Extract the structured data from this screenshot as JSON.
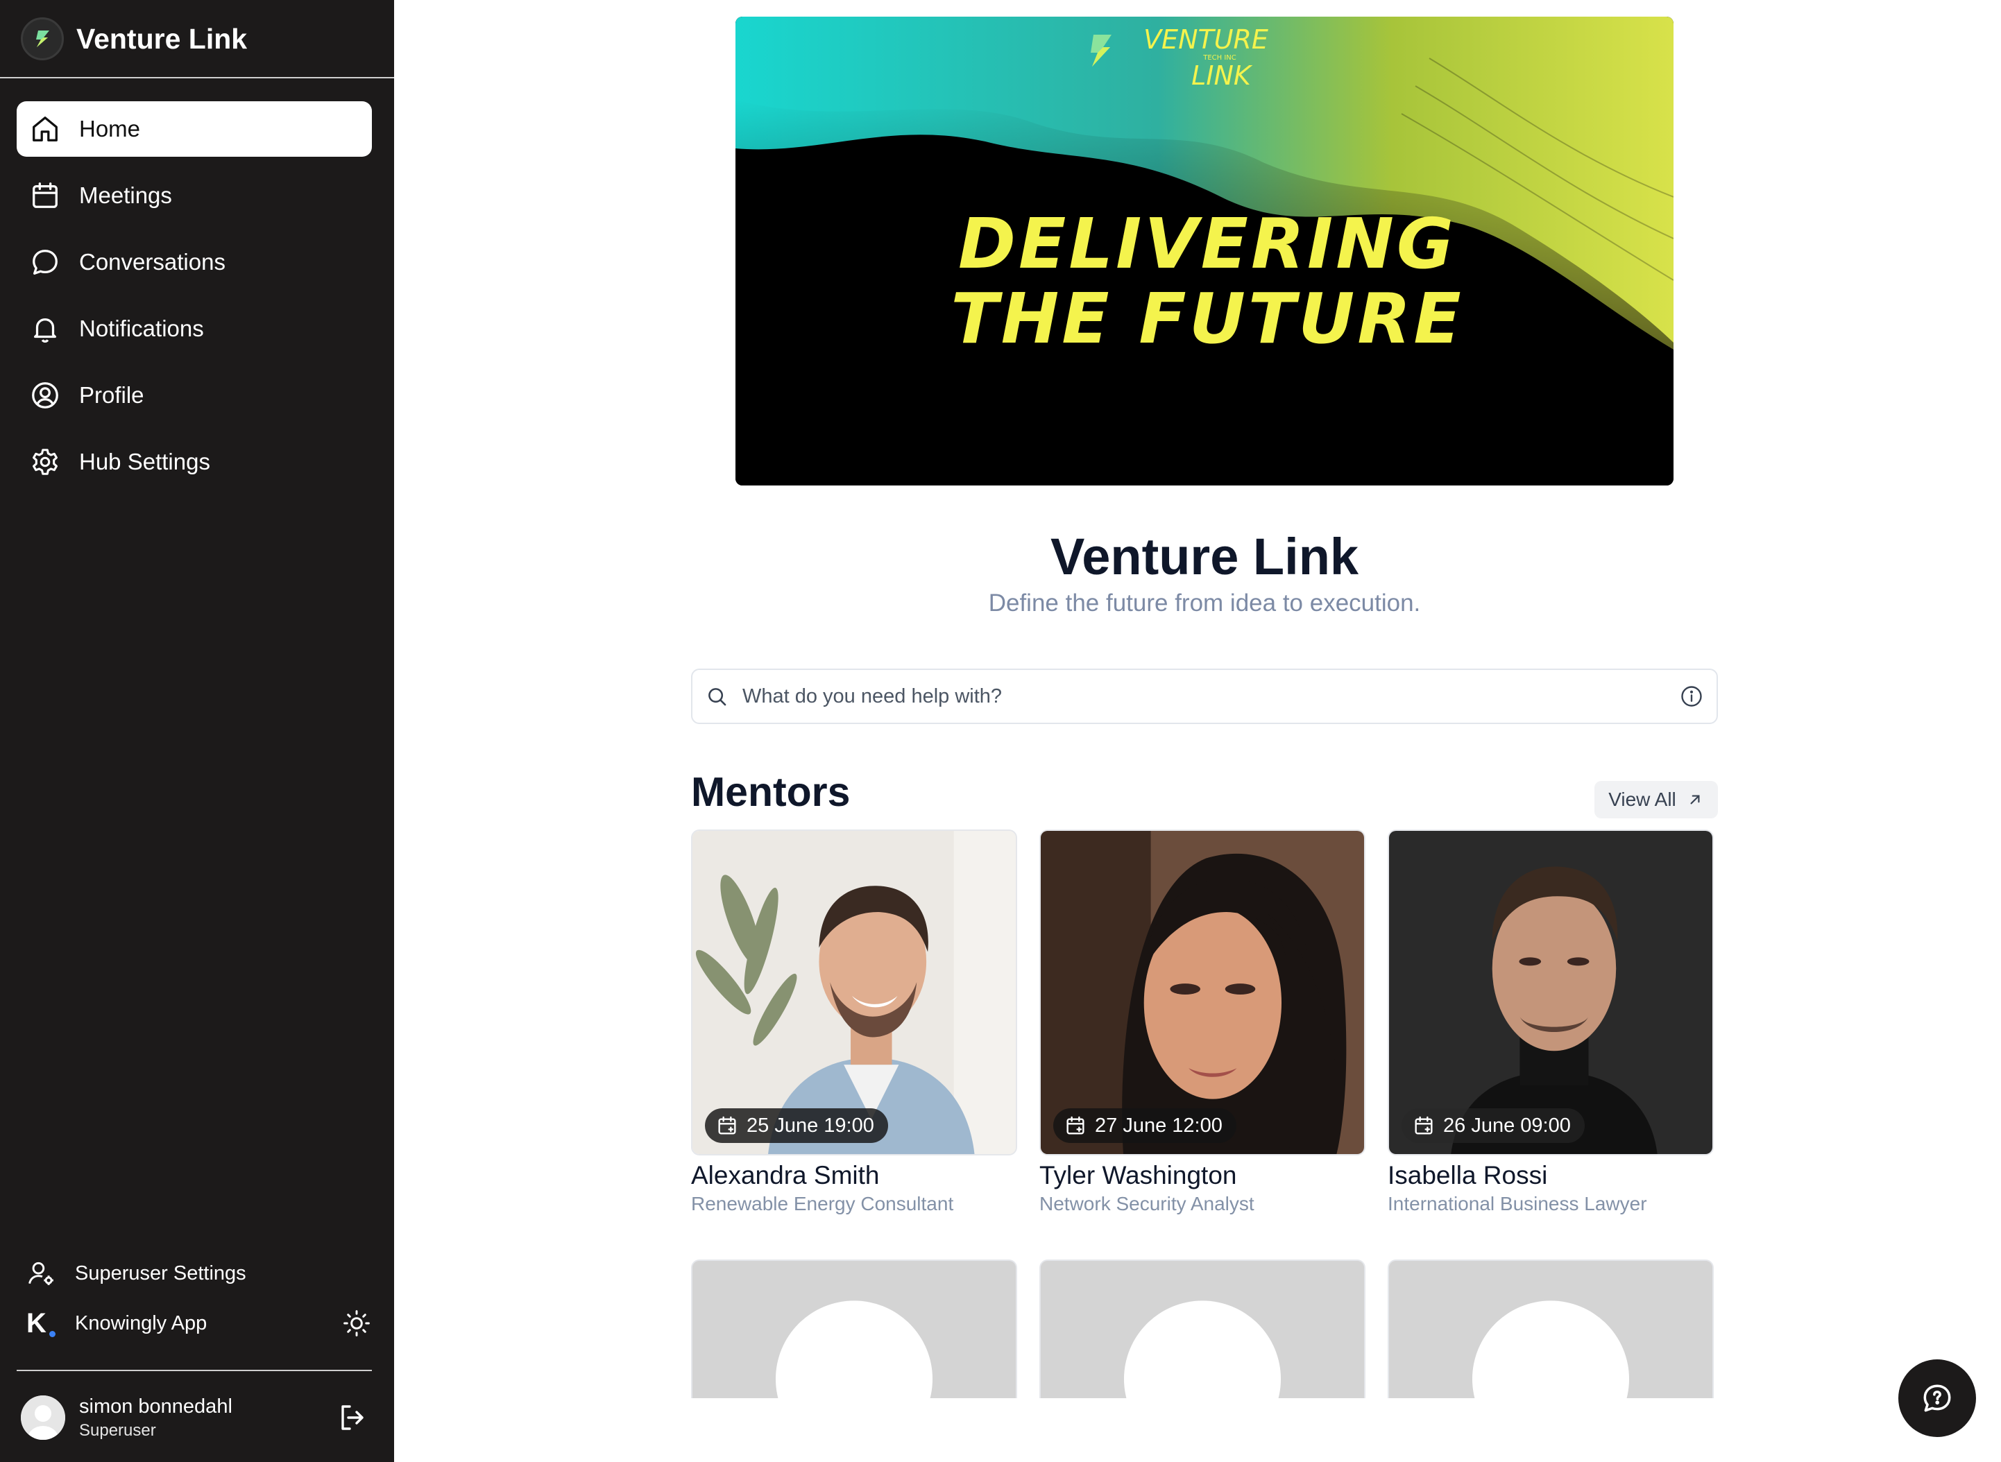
{
  "sidebar": {
    "brand_name": "Venture Link",
    "items": [
      {
        "label": "Home",
        "icon": "home-icon",
        "active": true
      },
      {
        "label": "Meetings",
        "icon": "calendar-icon"
      },
      {
        "label": "Conversations",
        "icon": "chat-bubble-icon"
      },
      {
        "label": "Notifications",
        "icon": "bell-icon"
      },
      {
        "label": "Profile",
        "icon": "user-circle-icon"
      },
      {
        "label": "Hub Settings",
        "icon": "gear-icon"
      }
    ],
    "bottom_links": [
      {
        "label": "Superuser Settings",
        "icon": "user-gear-icon"
      },
      {
        "label": "Knowingly App",
        "icon": "knowingly-logo-icon"
      }
    ],
    "user": {
      "name": "simon bonnedahl",
      "role": "Superuser"
    }
  },
  "banner": {
    "logo_top": "VENTURE",
    "logo_small": "TECH INC",
    "logo_bottom": "LINK",
    "headline_line1": "DELIVERING",
    "headline_line2": "THE FUTURE"
  },
  "hub": {
    "title": "Venture Link",
    "subtitle": "Define the future from idea to execution."
  },
  "search": {
    "placeholder": "What do you need help with?",
    "value": ""
  },
  "mentors": {
    "heading": "Mentors",
    "view_all_label": "View All",
    "cards": [
      {
        "name": "Alexandra Smith",
        "role": "Renewable Energy Consultant",
        "date": "25 June 19:00"
      },
      {
        "name": "Tyler Washington",
        "role": "Network Security Analyst",
        "date": "27 June 12:00"
      },
      {
        "name": "Isabella Rossi",
        "role": "International Business Lawyer",
        "date": "26 June 09:00"
      }
    ]
  },
  "colors": {
    "sidebar_bg": "#1c1a1a",
    "accent_yellow": "#f4f34d",
    "muted_text": "#7c8aa5"
  }
}
